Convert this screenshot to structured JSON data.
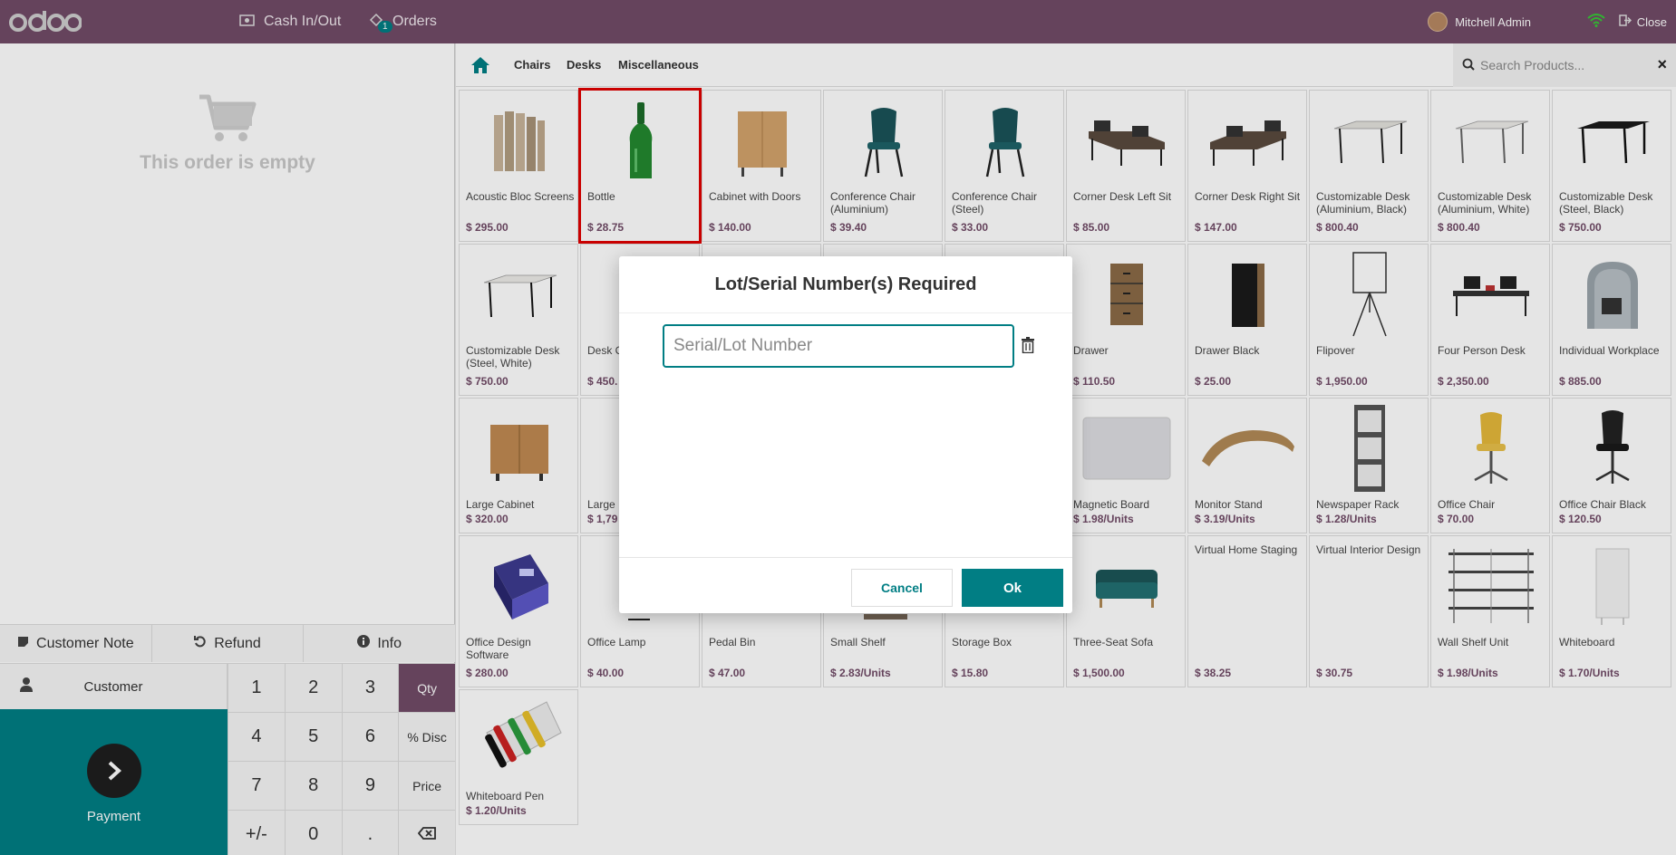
{
  "navbar": {
    "logo_text": "odoo",
    "cash_label": "Cash In/Out",
    "orders_label": "Orders",
    "orders_badge": "1",
    "user_name": "Mitchell Admin",
    "close_label": "Close",
    "bg_color": "#714b67"
  },
  "order": {
    "empty_text": "This order is empty"
  },
  "controls": {
    "customer_note": "Customer Note",
    "refund": "Refund",
    "info": "Info",
    "customer": "Customer",
    "payment": "Payment",
    "keys": [
      "1",
      "2",
      "3",
      "Qty",
      "4",
      "5",
      "6",
      "% Disc",
      "7",
      "8",
      "9",
      "Price",
      "+/-",
      "0",
      ".",
      "⌫"
    ]
  },
  "categories": {
    "items": [
      "Chairs",
      "Desks",
      "Miscellaneous"
    ],
    "search_placeholder": "Search Products..."
  },
  "products": [
    {
      "name": "Acoustic Bloc Screens",
      "price": "$ 295.00"
    },
    {
      "name": "Bottle",
      "price": "$ 28.75"
    },
    {
      "name": "Cabinet with Doors",
      "price": "$ 140.00"
    },
    {
      "name": "Conference Chair (Aluminium)",
      "price": "$ 39.40"
    },
    {
      "name": "Conference Chair (Steel)",
      "price": "$ 33.00"
    },
    {
      "name": "Corner Desk Left Sit",
      "price": "$ 85.00"
    },
    {
      "name": "Corner Desk Right Sit",
      "price": "$ 147.00"
    },
    {
      "name": "Customizable Desk (Aluminium, Black)",
      "price": "$ 800.40"
    },
    {
      "name": "Customizable Desk (Aluminium, White)",
      "price": "$ 800.40"
    },
    {
      "name": "Customizable Desk (Steel, Black)",
      "price": "$ 750.00"
    },
    {
      "name": "Customizable Desk (Steel, White)",
      "price": "$ 750.00"
    },
    {
      "name": "Desk C",
      "price": "$ 450."
    },
    {
      "name": "",
      "price": ""
    },
    {
      "name": "",
      "price": ""
    },
    {
      "name": "",
      "price": ""
    },
    {
      "name": "Drawer",
      "price": "$ 110.50"
    },
    {
      "name": "Drawer Black",
      "price": "$ 25.00"
    },
    {
      "name": "Flipover",
      "price": "$ 1,950.00"
    },
    {
      "name": "Four Person Desk",
      "price": "$ 2,350.00"
    },
    {
      "name": "Individual Workplace",
      "price": "$ 885.00"
    },
    {
      "name": "Large Cabinet",
      "price": "$ 320.00"
    },
    {
      "name": "Large I",
      "price": "$ 1,79"
    },
    {
      "name": "",
      "price": ""
    },
    {
      "name": "",
      "price": ""
    },
    {
      "name": "",
      "price": ""
    },
    {
      "name": "Magnetic Board",
      "price": "$ 1.98/Units"
    },
    {
      "name": "Monitor Stand",
      "price": "$ 3.19/Units"
    },
    {
      "name": "Newspaper Rack",
      "price": "$ 1.28/Units"
    },
    {
      "name": "Office Chair",
      "price": "$ 70.00"
    },
    {
      "name": "Office Chair Black",
      "price": "$ 120.50"
    },
    {
      "name": "Office Design Software",
      "price": "$ 280.00"
    },
    {
      "name": "Office Lamp",
      "price": "$ 40.00"
    },
    {
      "name": "Pedal Bin",
      "price": "$ 47.00"
    },
    {
      "name": "Small Shelf",
      "price": "$ 2.83/Units"
    },
    {
      "name": "Storage Box",
      "price": "$ 15.80"
    },
    {
      "name": "Three-Seat Sofa",
      "price": "$ 1,500.00"
    },
    {
      "name": "Virtual Home Staging",
      "price": "$ 38.25"
    },
    {
      "name": "Virtual Interior Design",
      "price": "$ 30.75"
    },
    {
      "name": "Wall Shelf Unit",
      "price": "$ 1.98/Units"
    },
    {
      "name": "Whiteboard",
      "price": "$ 1.70/Units"
    },
    {
      "name": "Whiteboard Pen",
      "price": "$ 1.20/Units"
    }
  ],
  "dialog": {
    "title": "Lot/Serial Number(s) Required",
    "input_placeholder": "Serial/Lot Number",
    "input_value": "",
    "cancel": "Cancel",
    "ok": "Ok"
  }
}
